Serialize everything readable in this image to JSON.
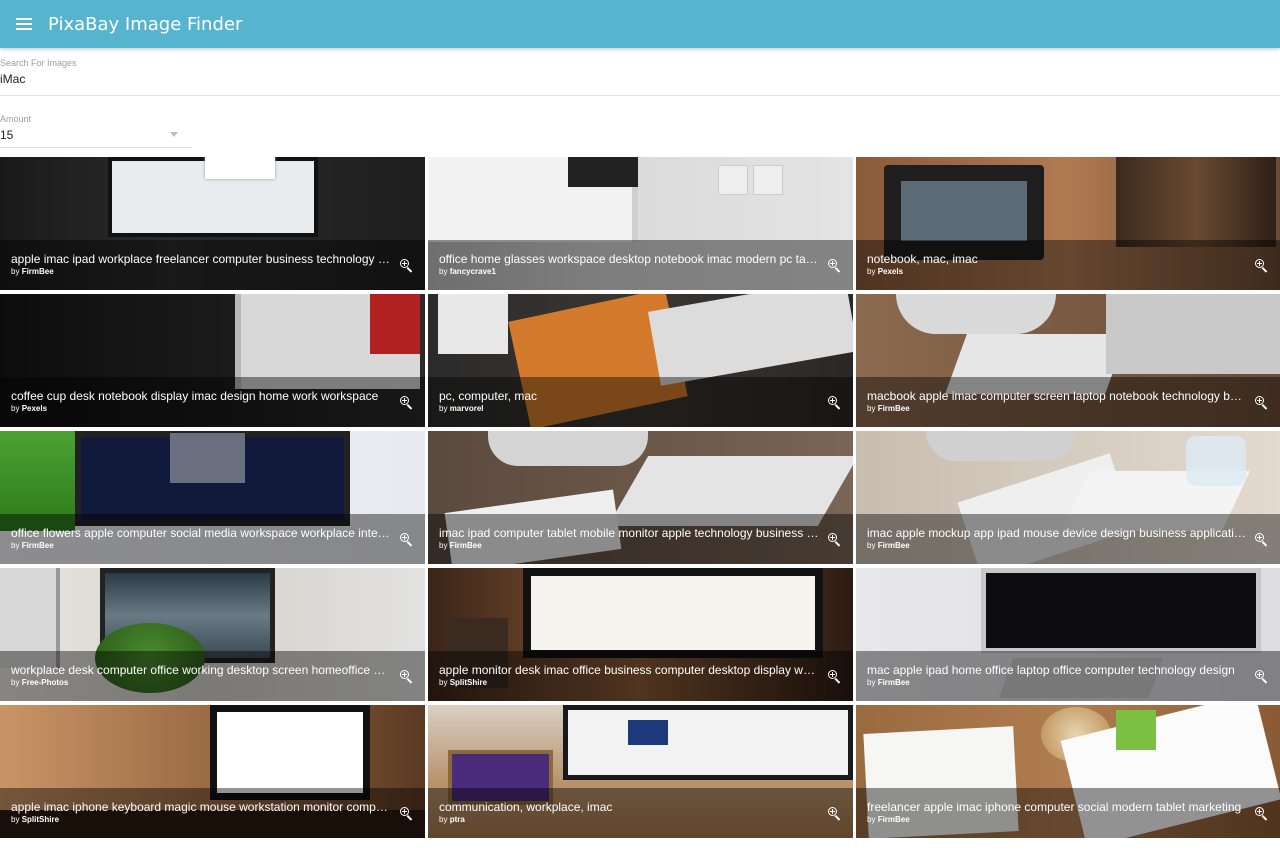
{
  "appbar": {
    "title": "PixaBay Image Finder",
    "menu_icon": "menu-icon",
    "color": "#56b4cf"
  },
  "search": {
    "label": "Search For Images",
    "value": "iMac"
  },
  "amount": {
    "label": "Amount",
    "value": "15"
  },
  "images": [
    {
      "title": "apple imac ipad workplace freelancer computer business technology time",
      "by_prefix": "by",
      "author": "FirmBee"
    },
    {
      "title": "office home glasses workspace desktop notebook imac modern pc table",
      "by_prefix": "by",
      "author": "fancycrave1"
    },
    {
      "title": "notebook, mac, imac",
      "by_prefix": "by",
      "author": "Pexels"
    },
    {
      "title": "coffee cup desk notebook display imac design home work workspace",
      "by_prefix": "by",
      "author": "Pexels"
    },
    {
      "title": "pc, computer, mac",
      "by_prefix": "by",
      "author": "marvorel"
    },
    {
      "title": "macbook apple imac computer screen laptop notebook technology business",
      "by_prefix": "by",
      "author": "FirmBee"
    },
    {
      "title": "office flowers apple computer social media workspace workplace internet",
      "by_prefix": "by",
      "author": "FirmBee"
    },
    {
      "title": "imac ipad computer tablet mobile monitor apple technology business office",
      "by_prefix": "by",
      "author": "FirmBee"
    },
    {
      "title": "imac apple mockup app ipad mouse device design business application",
      "by_prefix": "by",
      "author": "FirmBee"
    },
    {
      "title": "workplace desk computer office working desktop screen homeoffice business",
      "by_prefix": "by",
      "author": "Free-Photos"
    },
    {
      "title": "apple monitor desk imac office business computer desktop display work",
      "by_prefix": "by",
      "author": "SplitShire"
    },
    {
      "title": "mac apple ipad home office laptop office computer technology design",
      "by_prefix": "by",
      "author": "FirmBee"
    },
    {
      "title": "apple imac iphone keyboard magic mouse workstation monitor computer",
      "by_prefix": "by",
      "author": "SplitShire"
    },
    {
      "title": "communication, workplace, imac",
      "by_prefix": "by",
      "author": "ptra"
    },
    {
      "title": "freelancer apple imac iphone computer social modern tablet marketing",
      "by_prefix": "by",
      "author": "FirmBee"
    }
  ],
  "zoom_icon": "zoom-in-icon"
}
